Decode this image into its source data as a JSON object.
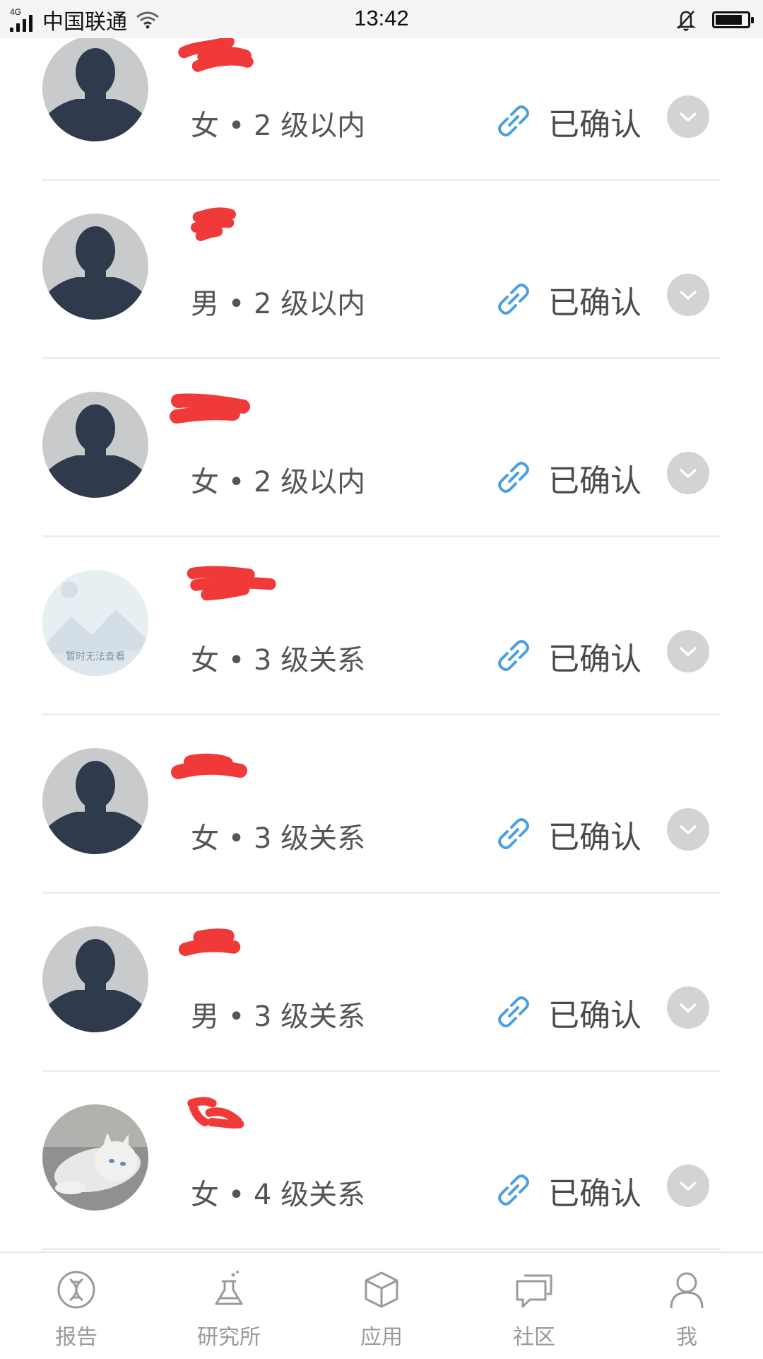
{
  "status_bar": {
    "network": "4G",
    "carrier": "中国联通",
    "time": "13:42",
    "battery_level": 0.85
  },
  "contacts": [
    {
      "avatar": "default-silhouette",
      "meta": "女 • 2 级以内",
      "status": "已确认"
    },
    {
      "avatar": "default-silhouette",
      "meta": "男 • 2 级以内",
      "status": "已确认"
    },
    {
      "avatar": "default-silhouette",
      "meta": "女 • 2 级以内",
      "status": "已确认"
    },
    {
      "avatar": "image-unavailable",
      "avatar_text": "暂时无法查看",
      "meta": "女 • 3 级关系",
      "status": "已确认"
    },
    {
      "avatar": "default-silhouette",
      "meta": "女 • 3 级关系",
      "status": "已确认"
    },
    {
      "avatar": "default-silhouette",
      "meta": "男 • 3 级关系",
      "status": "已确认"
    },
    {
      "avatar": "cat-photo",
      "meta": "女 • 4 级关系",
      "status": "已确认"
    }
  ],
  "tabbar": {
    "items": [
      {
        "label": "报告",
        "icon": "dna-icon"
      },
      {
        "label": "研究所",
        "icon": "flask-icon"
      },
      {
        "label": "应用",
        "icon": "cube-icon"
      },
      {
        "label": "社区",
        "icon": "chat-icon"
      },
      {
        "label": "我",
        "icon": "person-icon"
      }
    ]
  },
  "colors": {
    "link_blue": "#4a9fe0",
    "redaction_red": "#f03a3a",
    "expand_gray": "#d3d3d3",
    "avatar_bg": "#c9cacc",
    "avatar_fg": "#2f3b4c"
  }
}
